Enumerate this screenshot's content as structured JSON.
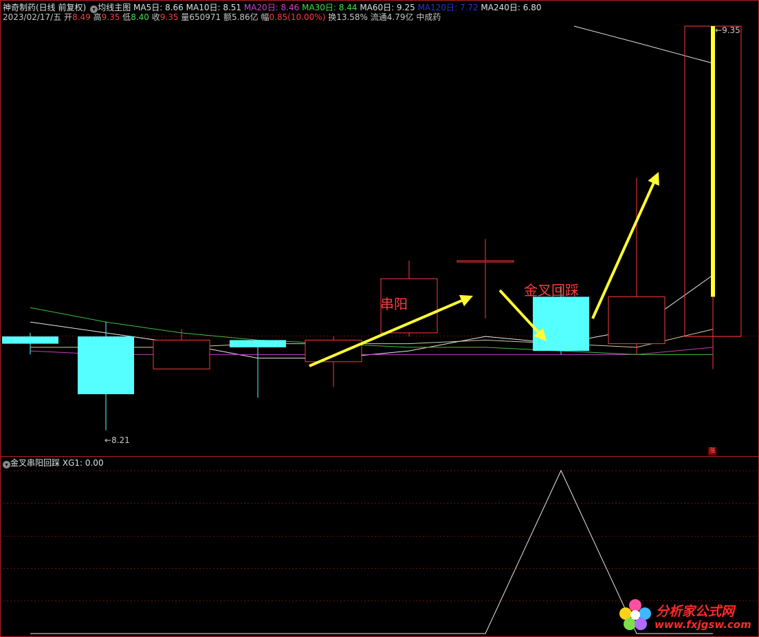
{
  "header": {
    "stock_name": "神奇制药(日线 前复权)",
    "indicator_menu_icon": "circle-chevron-down-icon",
    "main_indicator": "均线主图",
    "ma": [
      {
        "label": "MA5日: 8.66",
        "color": "#e0e0e0"
      },
      {
        "label": "MA10日: 8.51",
        "color": "#e0e0e0"
      },
      {
        "label": "MA20日: 8.46",
        "color": "#d040d0"
      },
      {
        "label": "MA30日: 8.44",
        "color": "#40e040"
      },
      {
        "label": "MA60日: 9.25",
        "color": "#e0e0e0"
      },
      {
        "label": "MA120日: 7.72",
        "color": "#3030d0"
      },
      {
        "label": "MA240日: 6.80",
        "color": "#e0e0e0"
      }
    ]
  },
  "quote": {
    "date": "2023/02/17/五",
    "open_label": "开",
    "open": "8.49",
    "high_label": "高",
    "high": "9.35",
    "low_label": "低",
    "low": "8.40",
    "close_label": "收",
    "close": "9.35",
    "volume_label": "量",
    "volume": "650971",
    "amount": "额5.86亿",
    "change_label": "幅",
    "change": "0.85(10.00%)",
    "turnover": "换13.58%",
    "float_cap": "流通4.79亿",
    "sector": "中成药"
  },
  "colors": {
    "up": "#ff3b3b",
    "down": "#55ffff",
    "limit_up": "#ffff33",
    "arrow": "#ffff33",
    "annotation": "#ff3b3b",
    "frame": "#b22222"
  },
  "chart": {
    "high_marker": "9.35",
    "low_marker": "8.21",
    "candles": [
      {
        "dir": "down",
        "open": 8.49,
        "close": 8.47,
        "high": 8.5,
        "low": 8.44
      },
      {
        "dir": "down",
        "open": 8.49,
        "close": 8.33,
        "high": 8.53,
        "low": 8.23
      },
      {
        "dir": "up",
        "open": 8.4,
        "close": 8.48,
        "high": 8.51,
        "low": 8.4
      },
      {
        "dir": "down",
        "open": 8.48,
        "close": 8.46,
        "high": 8.48,
        "low": 8.32
      },
      {
        "dir": "up",
        "open": 8.42,
        "close": 8.48,
        "high": 8.49,
        "low": 8.35
      },
      {
        "dir": "up",
        "open": 8.5,
        "close": 8.65,
        "high": 8.7,
        "low": 8.49
      },
      {
        "dir": "up",
        "open": 8.7,
        "close": 8.7,
        "high": 8.76,
        "low": 8.54
      },
      {
        "dir": "down",
        "open": 8.6,
        "close": 8.45,
        "high": 8.63,
        "low": 8.44
      },
      {
        "dir": "up",
        "open": 8.47,
        "close": 8.6,
        "high": 8.93,
        "low": 8.44
      },
      {
        "dir": "up",
        "open": 8.49,
        "close": 9.35,
        "high": 9.35,
        "low": 8.4
      }
    ],
    "annotations": [
      {
        "text": "串阳"
      },
      {
        "text": "金叉回踩"
      }
    ],
    "limit_up_icon": "涨"
  },
  "sub_chart": {
    "title": "金叉串阳回踩",
    "value": "XG1: 0.00",
    "signal": [
      0,
      0,
      0,
      0,
      0,
      0,
      0,
      1,
      0,
      0
    ]
  },
  "watermark": {
    "logo_icon": "flower-logo-icon",
    "name": "分析家公式网",
    "url": "www.fxjgsw.com"
  }
}
